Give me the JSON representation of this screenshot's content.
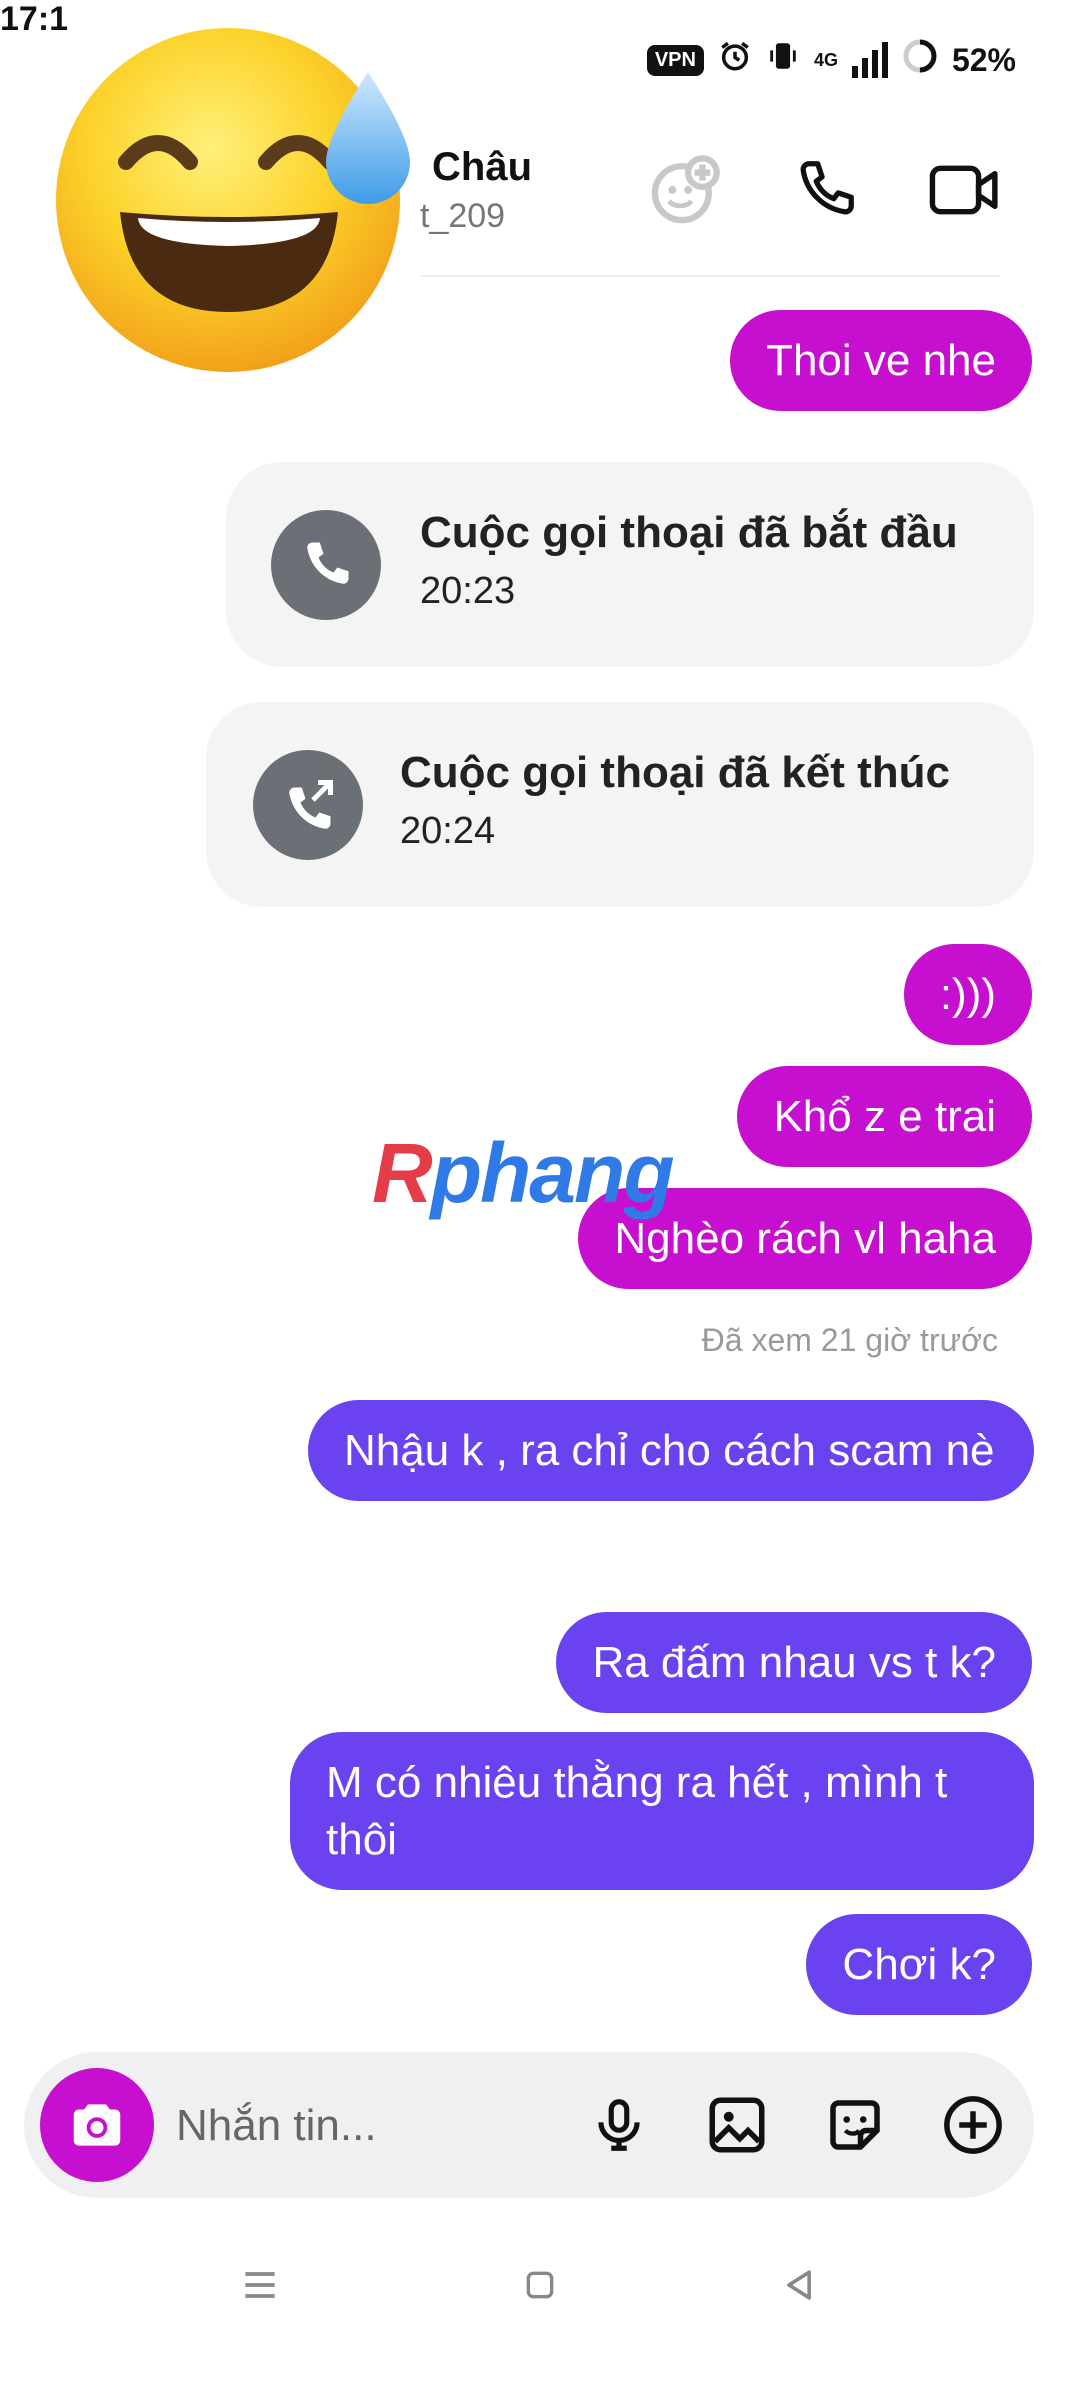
{
  "status_bar": {
    "time": "17:1",
    "vpn_label": "VPN",
    "network": "4G",
    "battery": "52%"
  },
  "header": {
    "name": "Châu",
    "username": "t_209"
  },
  "messages": [
    {
      "text": "Thoi ve nhe",
      "color": "#c60fcf"
    },
    {
      "text": ":)))",
      "color": "#c60fcf"
    },
    {
      "text": "Khổ z e trai",
      "color": "#c60fcf"
    },
    {
      "text": "Nghèo rách vl haha",
      "color": "#c60fcf"
    },
    {
      "text": "Nhậu k , ra chỉ cho cách scam nè",
      "color": "#6a42ef"
    },
    {
      "text": "Ra đấm nhau vs t k?",
      "color": "#6a42ef"
    },
    {
      "text": "M có nhiêu thằng ra hết , mình t thôi",
      "color": "#6a42ef"
    },
    {
      "text": "Chơi k?",
      "color": "#6a42ef"
    }
  ],
  "calls": [
    {
      "title": "Cuộc gọi thoại đã bắt đầu",
      "time": "20:23",
      "icon": "phone-icon"
    },
    {
      "title": "Cuộc gọi thoại đã kết thúc",
      "time": "20:24",
      "icon": "phone-outgoing-icon"
    }
  ],
  "seen": "Đã xem 21 giờ trước",
  "watermark": {
    "part1": "R",
    "part2": "phang"
  },
  "composer": {
    "placeholder": "Nhắn tin..."
  },
  "colors": {
    "pink": "#c60fcf",
    "purple": "#6a42ef",
    "card_bg": "#f4f4f5"
  }
}
